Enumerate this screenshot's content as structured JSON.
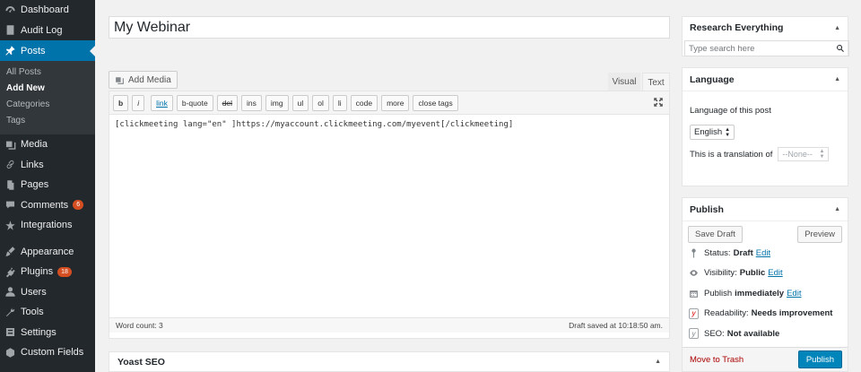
{
  "sidebar": {
    "items": [
      {
        "label": "Dashboard",
        "icon": "dashboard-icon"
      },
      {
        "label": "Audit Log",
        "icon": "audit-log-icon"
      },
      {
        "label": "Posts",
        "icon": "pin-icon"
      },
      {
        "label": "Media",
        "icon": "media-icon"
      },
      {
        "label": "Links",
        "icon": "link-icon"
      },
      {
        "label": "Pages",
        "icon": "pages-icon"
      },
      {
        "label": "Comments",
        "icon": "comment-icon",
        "badge": "6"
      },
      {
        "label": "Integrations",
        "icon": "integrations-icon"
      },
      {
        "label": "Appearance",
        "icon": "brush-icon"
      },
      {
        "label": "Plugins",
        "icon": "plugin-icon",
        "badge": "18"
      },
      {
        "label": "Users",
        "icon": "user-icon"
      },
      {
        "label": "Tools",
        "icon": "wrench-icon"
      },
      {
        "label": "Settings",
        "icon": "settings-icon"
      },
      {
        "label": "Custom Fields",
        "icon": "custom-fields-icon"
      }
    ],
    "posts_submenu": [
      "All Posts",
      "Add New",
      "Categories",
      "Tags"
    ]
  },
  "post": {
    "title": "My Webinar"
  },
  "editor": {
    "add_media": "Add Media",
    "tab_visual": "Visual",
    "tab_text": "Text",
    "toolbar": [
      "b",
      "i",
      "link",
      "b-quote",
      "del",
      "ins",
      "img",
      "ul",
      "ol",
      "li",
      "code",
      "more",
      "close tags"
    ],
    "content": "[clickmeeting lang=\"en\" ]https://myaccount.clickmeeting.com/myevent[/clickmeeting]",
    "word_count": "Word count: 3",
    "draft_saved": "Draft saved at 10:18:50 am."
  },
  "yoast": {
    "title": "Yoast SEO"
  },
  "research": {
    "title": "Research Everything",
    "placeholder": "Type search here"
  },
  "language": {
    "title": "Language",
    "label": "Language of this post",
    "selected": "English",
    "translation_label": "This is a translation of",
    "translation_value": "--None--"
  },
  "publish": {
    "title": "Publish",
    "save_draft": "Save Draft",
    "preview": "Preview",
    "status_label": "Status:",
    "status_value": "Draft",
    "visibility_label": "Visibility:",
    "visibility_value": "Public",
    "publish_label": "Publish",
    "publish_value": "immediately",
    "edit": "Edit",
    "readability_label": "Readability:",
    "readability_value": "Needs improvement",
    "seo_label": "SEO:",
    "seo_value": "Not available",
    "trash": "Move to Trash",
    "publish_button": "Publish"
  }
}
